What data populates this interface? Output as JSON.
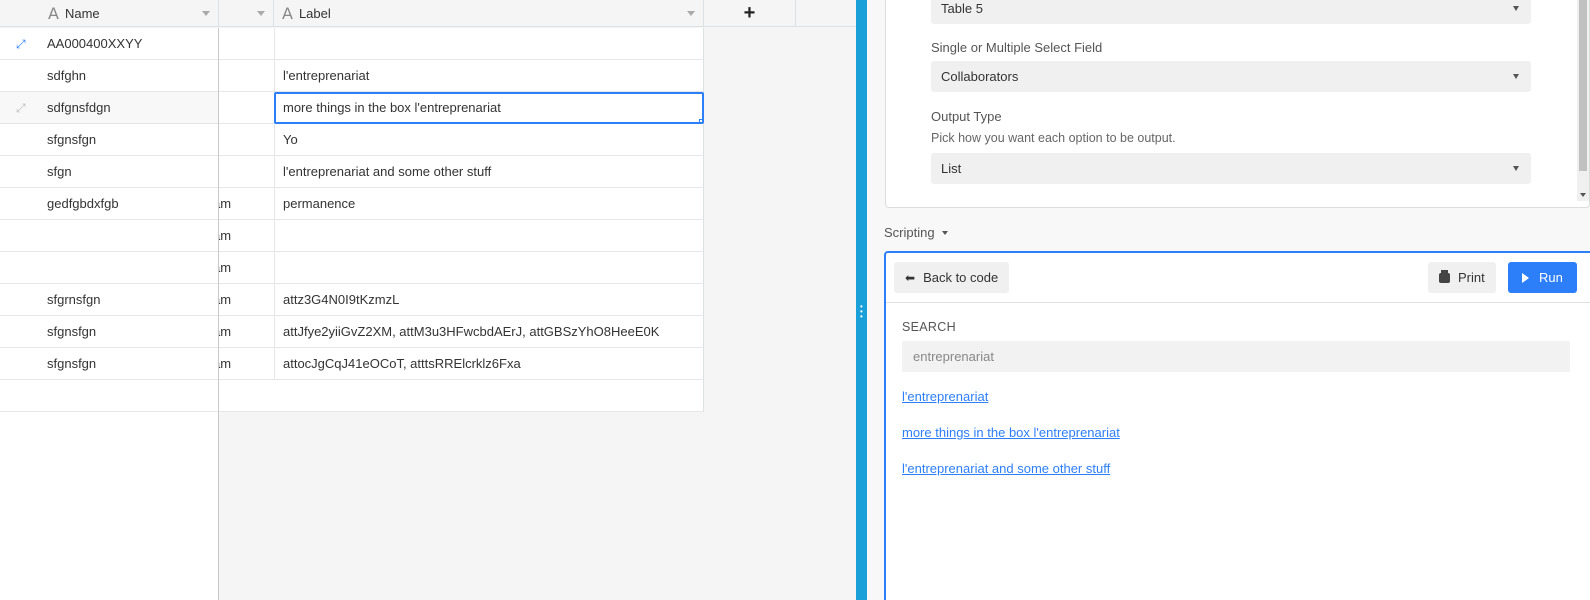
{
  "grid": {
    "columns": {
      "name": "Name",
      "label": "Label",
      "add": "+"
    },
    "rows": [
      {
        "name": "AA000400XXYY",
        "partial": "",
        "label": "",
        "expand": "active"
      },
      {
        "name": "sdfghn",
        "partial": "",
        "label": "l'entreprenariat",
        "expand": ""
      },
      {
        "name": "sdfgnsfdgn",
        "partial": "",
        "label": "more things in the box l'entreprenariat",
        "expand": "hover",
        "selected": true
      },
      {
        "name": "sfgnsfgn",
        "partial": "",
        "label": "Yo",
        "expand": ""
      },
      {
        "name": "sfgn",
        "partial": "",
        "label": "l'entreprenariat and some other stuff",
        "expand": ""
      },
      {
        "name": "gedfgbdxfgb",
        "partial": "am",
        "label": "permanence",
        "expand": ""
      },
      {
        "name": "",
        "partial": "am",
        "label": "",
        "expand": ""
      },
      {
        "name": "",
        "partial": "am",
        "label": "",
        "expand": ""
      },
      {
        "name": "sfgrnsfgn",
        "partial": "am",
        "label": "attz3G4N0I9tKzmzL",
        "expand": ""
      },
      {
        "name": "sfgnsfgn",
        "partial": "am",
        "label": "attJfye2yiiGvZ2XM, attM3u3HFwcbdAErJ, attGBSzYhO8HeeE0K",
        "expand": ""
      },
      {
        "name": "sfgnsfgn",
        "partial": "am",
        "label": "attocJgCqJ41eOCoT, atttsRRElcrklz6Fxa",
        "expand": ""
      }
    ]
  },
  "settings": {
    "table_value": "Table 5",
    "select_field_label": "Single or Multiple Select Field",
    "select_field_value": "Collaborators",
    "output_type_label": "Output Type",
    "output_type_help": "Pick how you want each option to be output.",
    "output_type_value": "List"
  },
  "scripting": {
    "toggle_label": "Scripting",
    "back_label": "Back to code",
    "print_label": "Print",
    "run_label": "Run",
    "search_label": "SEARCH",
    "search_value": "entreprenariat",
    "results": [
      "l'entreprenariat",
      "more things in the box l'entreprenariat",
      "l'entreprenariat and some other stuff"
    ]
  },
  "colors": {
    "accent": "#2d7ff9",
    "divider": "#1aa0d8"
  }
}
